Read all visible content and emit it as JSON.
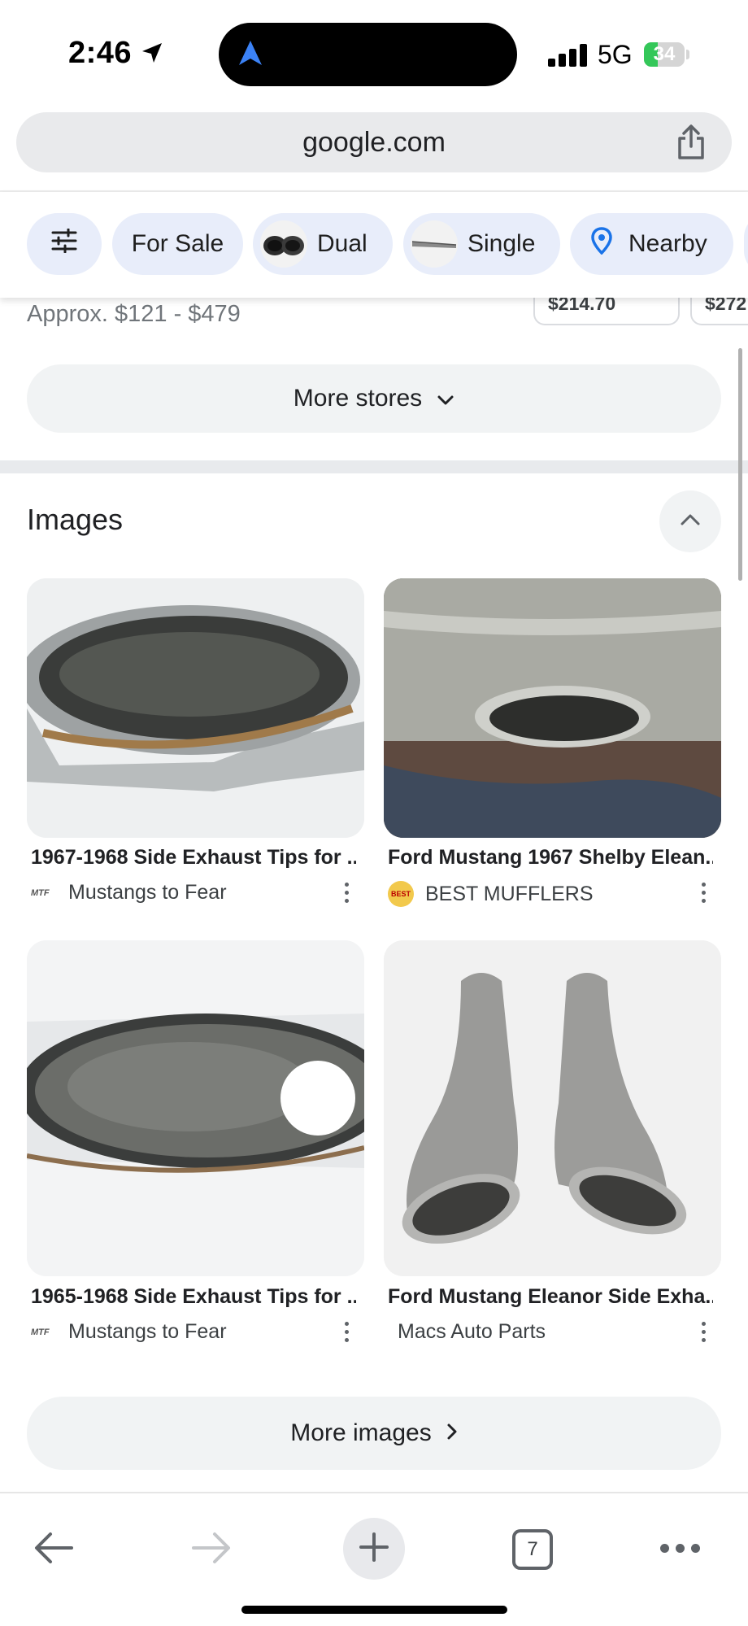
{
  "status_bar": {
    "time": "2:46",
    "network": "5G",
    "battery_level": "34",
    "battery_fraction": 0.34,
    "battery_color": "#34c759",
    "icons": [
      "location-arrow-icon",
      "navigation-icon",
      "signal-bars-icon",
      "battery-icon"
    ]
  },
  "browser": {
    "url": "google.com",
    "share_icon": "share-icon",
    "tab_count": "7"
  },
  "filter_chips": [
    {
      "label": "",
      "icon": "tune-icon"
    },
    {
      "label": "For Sale"
    },
    {
      "label": "Dual",
      "icon": "dual-exhaust-thumb"
    },
    {
      "label": "Single",
      "icon": "single-exhaust-thumb"
    },
    {
      "label": "Nearby",
      "icon": "location-pin-icon"
    }
  ],
  "stores": {
    "approx_price": "Approx. $121 - $479",
    "price_tags": [
      "$214.70",
      "$272"
    ],
    "more_stores_label": "More stores"
  },
  "images_section": {
    "title": "Images",
    "more_images_label": "More images",
    "results": [
      {
        "title": "1967-1968 Side Exhaust Tips for ...",
        "source": "Mustangs to Fear",
        "logo_text": "MTF"
      },
      {
        "title": "Ford Mustang 1967 Shelby Elean...",
        "source": "BEST MUFFLERS",
        "logo_text": "BEST"
      },
      {
        "title": "1965-1968 Side Exhaust Tips for ...",
        "source": "Mustangs to Fear",
        "logo_text": "MTF"
      },
      {
        "title": "Ford Mustang Eleanor Side Exha...",
        "source": "Macs Auto Parts",
        "logo_text": ""
      }
    ]
  },
  "colors": {
    "chip_bg": "#e8edfa",
    "accent_blue": "#1a73e8",
    "pill_bg": "#f1f3f4"
  }
}
